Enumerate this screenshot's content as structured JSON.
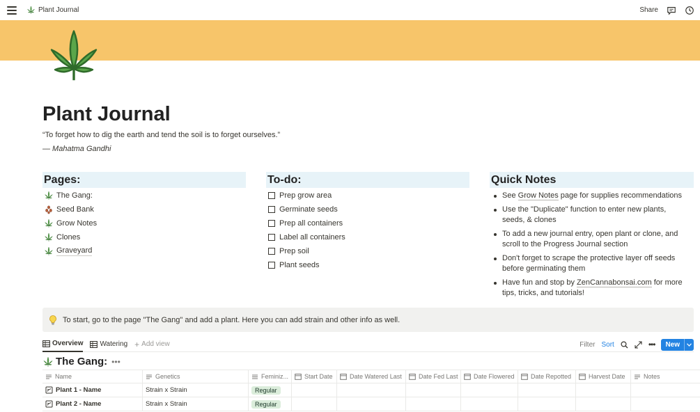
{
  "topbar": {
    "breadcrumb": "Plant Journal",
    "share_label": "Share"
  },
  "page": {
    "title": "Plant Journal",
    "quote": "“To forget how to dig the earth and tend the soil is to forget ourselves.”",
    "author": "— Mahatma Gandhi",
    "cover_color": "#f7c56a"
  },
  "pages_section": {
    "heading": "Pages:",
    "items": [
      {
        "label": "The Gang:",
        "icon": "cannabis-leaf-icon"
      },
      {
        "label": "Seed Bank",
        "icon": "seeds-icon"
      },
      {
        "label": "Grow Notes",
        "icon": "cannabis-leaf-icon"
      },
      {
        "label": "Clones",
        "icon": "cannabis-leaf-icon"
      },
      {
        "label": "Graveyard",
        "icon": "cannabis-leaf-icon"
      }
    ]
  },
  "todo_section": {
    "heading": "To-do:",
    "items": [
      "Prep grow area",
      "Germinate seeds",
      "Prep all containers",
      "Label all containers",
      "Prep soil",
      "Plant seeds"
    ]
  },
  "quick_notes": {
    "heading": "Quick Notes",
    "note1_pre": "See ",
    "note1_link": "Grow Notes",
    "note1_post": " page for supplies recommendations",
    "note2": "Use the \"Duplicate\" function to enter new plants, seeds, & clones",
    "note3": "To add a new journal entry, open plant or clone, and scroll to the Progress Journal section",
    "note4": "Don't forget to scrape the protective layer off seeds before germinating them",
    "note5_pre": "Have fun and stop by ",
    "note5_link": "ZenCannabonsai.com",
    "note5_post": " for more tips, tricks, and tutorials!"
  },
  "callout": {
    "icon": "lightbulb-icon",
    "text": "To start, go to the page \"The Gang\" and add a plant. Here you can add strain and other info as well."
  },
  "views": {
    "tabs": [
      "Overview",
      "Watering"
    ],
    "add_view": "Add view",
    "filter": "Filter",
    "sort": "Sort",
    "new": "New"
  },
  "database": {
    "title": "The Gang:",
    "columns": [
      "Name",
      "Genetics",
      "Feminiz...",
      "Start Date",
      "Date Watered Last",
      "Date Fed Last",
      "Date Flowered",
      "Date Repotted",
      "Harvest Date",
      "Notes"
    ],
    "rows": [
      {
        "name": "Plant 1 - Name",
        "genetics": "Strain x Strain",
        "feminized": "Regular"
      },
      {
        "name": "Plant 2 - Name",
        "genetics": "Strain x Strain",
        "feminized": "Regular"
      }
    ]
  }
}
